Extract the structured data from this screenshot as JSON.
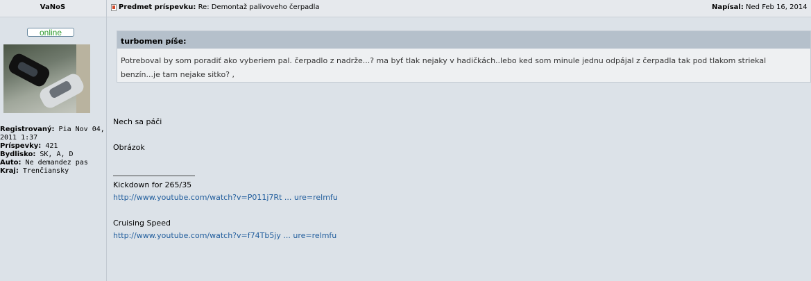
{
  "post": {
    "author": "VaNoS",
    "subject_label": "Predmet príspevku:",
    "subject": "Re: Demontaž palivoveho čerpadla",
    "posted_label": "Napísal:",
    "posted_value": "Ned Feb 16, 2014"
  },
  "profile": {
    "online": "online",
    "registered_label": "Registrovaný:",
    "registered_value": "Pia Nov 04, 2011 1:37",
    "posts_label": "Príspevky:",
    "posts_value": "421",
    "location_label": "Bydlisko:",
    "location_value": "SK, A, D",
    "car_label": "Auto:",
    "car_value": "Ne demandez pas",
    "region_label": "Kraj:",
    "region_value": "Trenčiansky"
  },
  "quote": {
    "author": "turbomen píše:",
    "text": "Potreboval by som poradiť ako vyberiem pal. čerpadlo z nadrže...? ma byť tlak nejaky v hadičkách..lebo ked som minule jednu odpájal z čerpadla tak pod tlakom striekal benzín...je tam nejake sitko? ,"
  },
  "body": {
    "line1": "Nech sa páči",
    "line2": "Obrázok"
  },
  "signature": {
    "label1": "Kickdown for 265/35",
    "link1": "http://www.youtube.com/watch?v=P011j7Rt ... ure=relmfu",
    "label2": "Cruising Speed",
    "link2": "http://www.youtube.com/watch?v=f74Tb5jy ... ure=relmfu"
  },
  "colors": {
    "background": "#dce2e8",
    "link": "#1f5c9c",
    "online": "#2e9a2e"
  }
}
